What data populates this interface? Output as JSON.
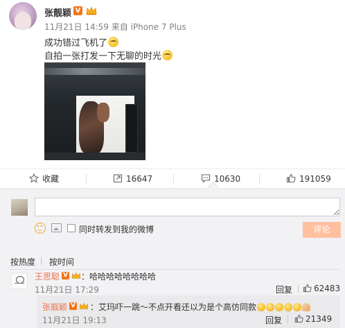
{
  "post": {
    "author": "张靓颖",
    "verified_badge": "V",
    "meta": "11月21日 14:59 来自 iPhone 7 Plus",
    "text_line1": "成功错过飞机了",
    "text_line2": "自拍一张打发一下无聊的时光",
    "colors": {
      "verified": "#f3741d",
      "name_link": "#eb7350"
    }
  },
  "actions": {
    "favorite_label": "收藏",
    "repost_count": "16647",
    "comment_count": "10630",
    "like_count": "191059"
  },
  "composer": {
    "input_value": "",
    "repost_checkbox_label": "同时转发到我的微博",
    "submit_label": "评论",
    "submit_color": "#ffc09f"
  },
  "sort": {
    "by_hot": "按热度",
    "by_time": "按时间"
  },
  "comment": {
    "author": "王思聪",
    "verified_badge": "V",
    "text": "：哈哈哈哈哈哈哈哈",
    "time": "11月21日 17:29",
    "reply_label": "回复",
    "like_count": "62483"
  },
  "reply": {
    "author": "张靓颖",
    "verified_badge": "V",
    "text": "：艾玛吓一跳～不点开看还以为是个高仿同款",
    "time": "11月21日 19:13",
    "reply_label": "回复",
    "like_count": "21349"
  }
}
